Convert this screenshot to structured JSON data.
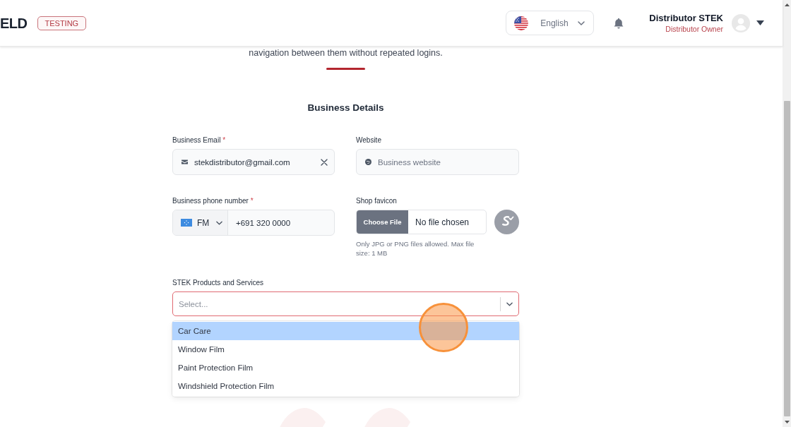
{
  "header": {
    "logo_text": "ELD",
    "env_badge": "TESTING",
    "language": {
      "label": "English"
    },
    "user": {
      "name": "Distributor STEK",
      "role": "Distributor Owner"
    }
  },
  "intro": {
    "text": "navigation between them without repeated logins."
  },
  "section": {
    "title": "Business Details"
  },
  "business_email": {
    "label": "Business Email",
    "required_mark": "*",
    "value": "stekdistributor@gmail.com"
  },
  "website": {
    "label": "Website",
    "placeholder": "Business website"
  },
  "phone": {
    "label": "Business phone number",
    "required_mark": "*",
    "country_code": "FM",
    "value": "+691 320 0000"
  },
  "shop_favicon": {
    "label": "Shop favicon",
    "button": "Choose File",
    "file_status": "No file chosen",
    "hint": "Only JPG or PNG files allowed. Max file size: 1 MB"
  },
  "products": {
    "label": "STEK Products and Services",
    "placeholder": "Select...",
    "invalid": true,
    "expanded": true,
    "options": [
      {
        "label": "Car Care",
        "selected": true
      },
      {
        "label": "Window Film",
        "selected": false
      },
      {
        "label": "Paint Protection Film",
        "selected": false
      },
      {
        "label": "Windshield Protection Film",
        "selected": false
      }
    ]
  }
}
